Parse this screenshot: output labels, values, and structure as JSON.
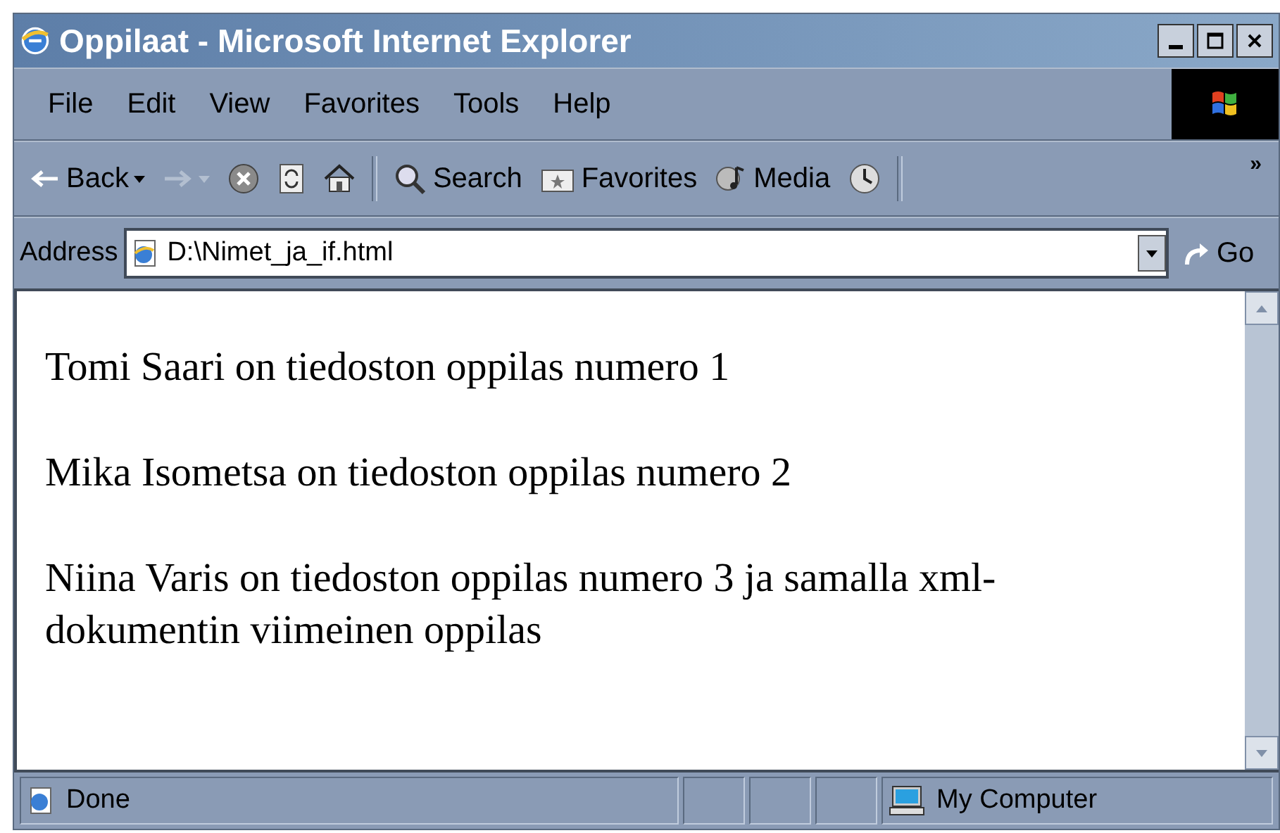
{
  "window": {
    "title": "Oppilaat - Microsoft Internet Explorer"
  },
  "menu": [
    "File",
    "Edit",
    "View",
    "Favorites",
    "Tools",
    "Help"
  ],
  "toolbar": [
    {
      "kind": "back",
      "label": "Back",
      "disabled": false
    },
    {
      "kind": "forward",
      "disabled": true
    },
    {
      "kind": "stop",
      "disabled": false
    },
    {
      "kind": "refresh",
      "disabled": false
    },
    {
      "kind": "home",
      "disabled": false
    },
    {
      "kind": "search",
      "label": "Search",
      "disabled": false
    },
    {
      "kind": "favorites",
      "label": "Favorites",
      "disabled": false
    },
    {
      "kind": "media",
      "label": "Media",
      "disabled": false
    },
    {
      "kind": "history",
      "disabled": false
    }
  ],
  "toolbar_more": "»",
  "address": {
    "label": "Address",
    "value": "D:\\Nimet_ja_if.html",
    "go": "Go"
  },
  "content": {
    "paragraphs": [
      "Tomi Saari on tiedoston oppilas numero 1",
      "Mika Isometsa on tiedoston oppilas numero 2",
      "Niina Varis on tiedoston oppilas numero 3 ja samalla xml-dokumentin viimeinen oppilas"
    ]
  },
  "status_bar": {
    "text": "Done",
    "zone": "My Computer"
  }
}
